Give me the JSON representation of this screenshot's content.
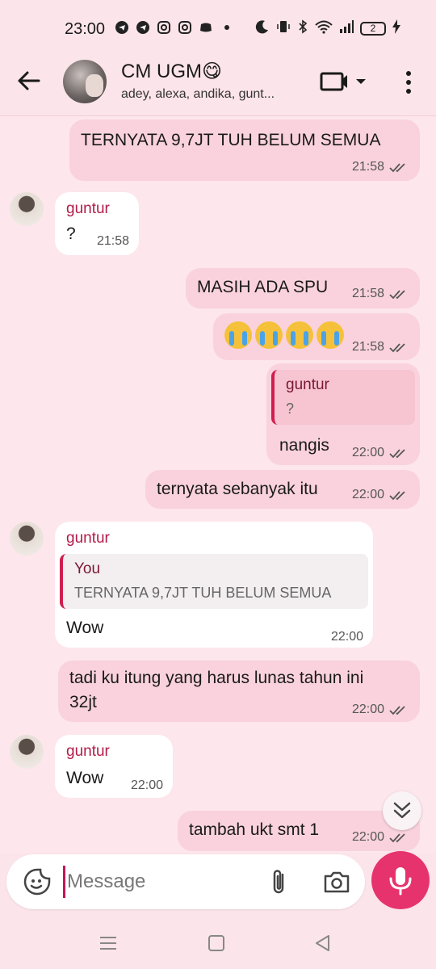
{
  "status_bar": {
    "time": "23:00",
    "battery": "2"
  },
  "header": {
    "title": "CM UGM😋",
    "subtitle": "adey, alexa, andika, gunt..."
  },
  "messages": [
    {
      "id": "m1",
      "direction": "out",
      "text": "TERNYATA 9,7JT TUH BELUM SEMUA",
      "time": "21:58"
    },
    {
      "id": "m2",
      "direction": "in",
      "sender": "guntur",
      "text": "?",
      "time": "21:58"
    },
    {
      "id": "m3",
      "direction": "out",
      "text": "MASIH ADA SPU",
      "time": "21:58"
    },
    {
      "id": "m4",
      "direction": "out",
      "text": "😭😭😭😭",
      "time": "21:58"
    },
    {
      "id": "m5",
      "direction": "out",
      "reply_to": {
        "name": "guntur",
        "text": "?"
      },
      "text": "nangis",
      "time": "22:00"
    },
    {
      "id": "m6",
      "direction": "out",
      "text": "ternyata sebanyak itu",
      "time": "22:00"
    },
    {
      "id": "m7",
      "direction": "in",
      "sender": "guntur",
      "reply_to": {
        "name": "You",
        "text": "TERNYATA 9,7JT TUH BELUM SEMUA"
      },
      "text": "Wow",
      "time": "22:00"
    },
    {
      "id": "m8",
      "direction": "out",
      "text_line1": "tadi ku itung yang harus lunas tahun ini",
      "text_line2": "32jt",
      "time": "22:00"
    },
    {
      "id": "m9",
      "direction": "in",
      "sender": "guntur",
      "text": "Wow",
      "time": "22:00"
    },
    {
      "id": "m10",
      "direction": "out",
      "text": "tambah ukt smt 1",
      "time": "22:00"
    }
  ],
  "composer": {
    "placeholder": "Message"
  },
  "colors": {
    "accent": "#e6336e",
    "sender": "#b31b4a",
    "outgoing_bubble": "#f9d2dd",
    "background": "#fde6ec"
  }
}
